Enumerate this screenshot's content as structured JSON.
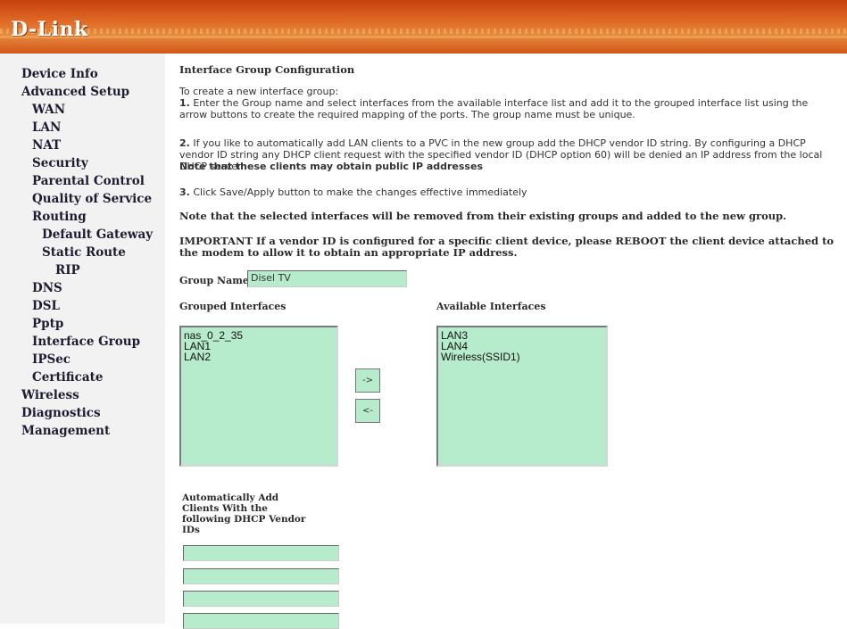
{
  "brand": {
    "logo": "D-Link"
  },
  "sidebar": {
    "items": [
      {
        "label": "Device Info"
      },
      {
        "label": "Advanced Setup"
      },
      {
        "label": "WAN"
      },
      {
        "label": "LAN"
      },
      {
        "label": "NAT"
      },
      {
        "label": "Security"
      },
      {
        "label": "Parental Control"
      },
      {
        "label": "Quality of Service"
      },
      {
        "label": "Routing"
      },
      {
        "label": "Default Gateway"
      },
      {
        "label": "Static Route"
      },
      {
        "label": "RIP"
      },
      {
        "label": "DNS"
      },
      {
        "label": "DSL"
      },
      {
        "label": "Pptp"
      },
      {
        "label": "Interface Group"
      },
      {
        "label": "IPSec"
      },
      {
        "label": "Certificate"
      },
      {
        "label": "Wireless"
      },
      {
        "label": "Diagnostics"
      },
      {
        "label": "Management"
      }
    ]
  },
  "main": {
    "title": "Interface Group Configuration",
    "intro": "To create a new interface group:",
    "step1_num": "1.",
    "step1_text": "Enter the Group name and select interfaces from the available interface list and add it to the grouped interface list using the arrow buttons to create the required mapping of the ports. The group name must be unique.",
    "step2_num": "2.",
    "step2_text": "If you like to automatically add LAN clients to a PVC in the new group add the DHCP vendor ID string. By configuring a DHCP vendor ID string any DHCP client request with the specified vendor ID (DHCP option 60) will be denied an IP address from the local DHCP server.",
    "step2_note": "Note that these clients may obtain public IP addresses",
    "step3_num": "3.",
    "step3_text": "Click Save/Apply button to make the changes effective immediately",
    "note_removed": "Note that the selected interfaces will be removed from their existing groups and added to the new group.",
    "important": "IMPORTANT If a vendor ID is configured for a specific client device, please REBOOT the client device attached to the modem to allow it to obtain an appropriate IP address.",
    "group_name_label": "Group Name:",
    "group_name_value": "Disel TV",
    "grouped_label": "Grouped Interfaces",
    "available_label": "Available Interfaces",
    "grouped_items": [
      "nas_0_2_35",
      "LAN1",
      "LAN2"
    ],
    "available_items": [
      "LAN3",
      "LAN4",
      "Wireless(SSID1)"
    ],
    "move_right": "->",
    "move_left": "<-",
    "vendor_label": "Automatically Add Clients With the following DHCP Vendor IDs",
    "vendor_ids": [
      "",
      "",
      "",
      ""
    ]
  },
  "colors": {
    "field_bg": "#b6eccc",
    "sidebar_bg": "#f2f2f2",
    "header": "#d9581c"
  }
}
